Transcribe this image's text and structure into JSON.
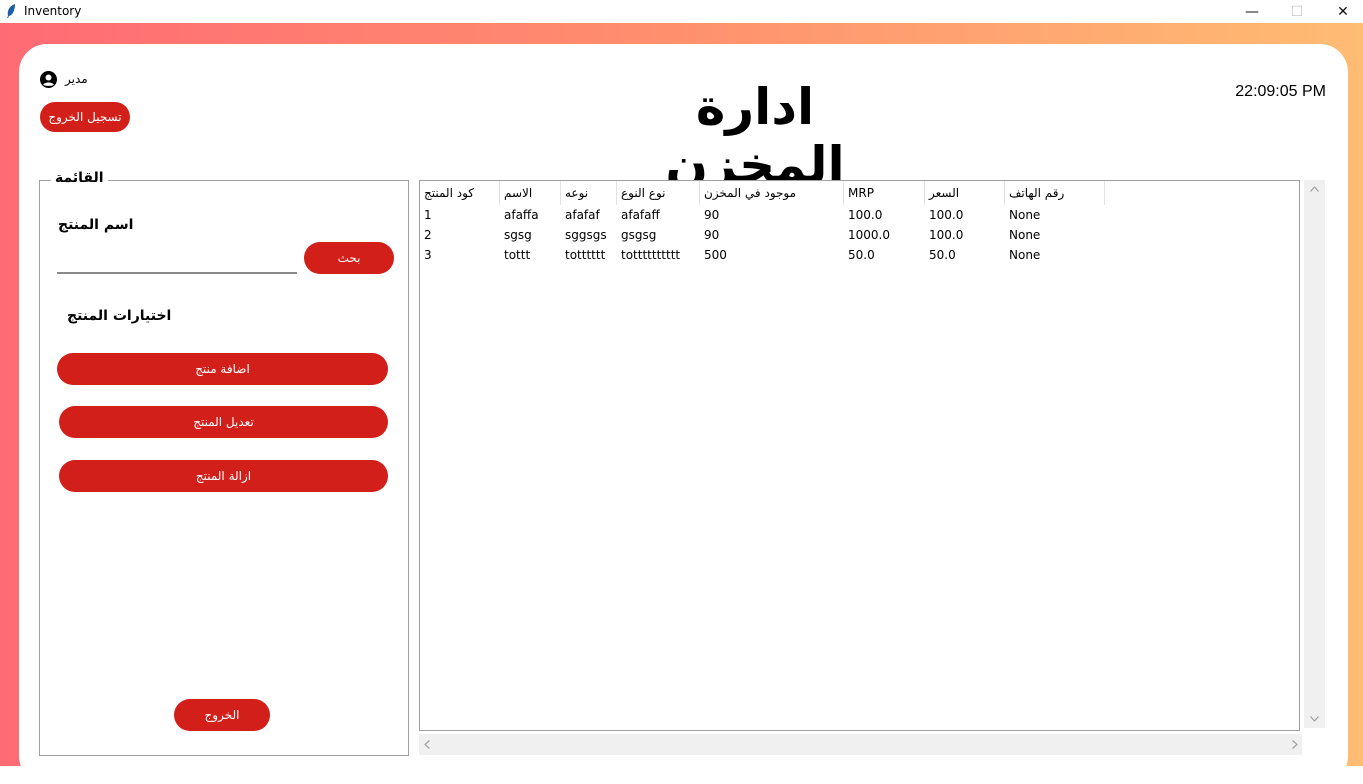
{
  "window": {
    "title": "Inventory",
    "minimize_glyph": "—",
    "maximize_glyph": "☐",
    "close_glyph": "✕"
  },
  "header": {
    "user_label": "مدير",
    "logout_label": "تسجيل الخروج",
    "title": "ادارة المخزن",
    "clock": "22:09:05 PM"
  },
  "menu": {
    "legend": "القائمة",
    "product_name_label": "اسم المنتج",
    "search_value": "",
    "search_button": "بحث",
    "options_label": "اختيارات المنتج",
    "add_button": "اضافة منتج",
    "edit_button": "تعديل المنتج",
    "remove_button": "ازالة المنتج",
    "exit_button": "الخروج"
  },
  "table": {
    "columns": [
      "كود المنتج",
      "الاسم",
      "نوعه",
      "نوع النوع",
      "موجود في المخزن",
      "MRP",
      "السعر",
      "رقم الهاتف"
    ],
    "rows": [
      [
        "1",
        "afaffa",
        "afafaf",
        "afafaff",
        "90",
        "100.0",
        "100.0",
        "None"
      ],
      [
        "2",
        "sgsg",
        "sggsgs",
        "gsgsg",
        "90",
        "1000.0",
        "100.0",
        "None"
      ],
      [
        "3",
        "tottt",
        "totttttt",
        "totttttttttt",
        "500",
        "50.0",
        "50.0",
        "None"
      ]
    ]
  },
  "colors": {
    "accent_red": "#d21f1a",
    "gradient_left": "#ff6b74",
    "gradient_right": "#ffbc73"
  },
  "icons": {
    "app": "feather-icon",
    "user": "user-circle-icon",
    "scroll_up": "chevron-up-icon",
    "scroll_down": "chevron-down-icon",
    "scroll_left": "chevron-left-icon",
    "scroll_right": "chevron-right-icon"
  }
}
